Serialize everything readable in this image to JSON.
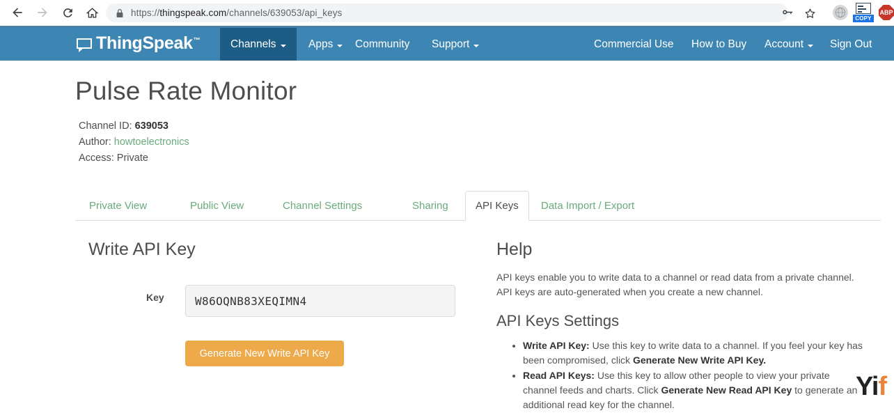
{
  "browser": {
    "back_icon": "back-arrow-icon",
    "forward_icon": "forward-arrow-icon",
    "reload_icon": "reload-icon",
    "home_icon": "home-icon",
    "lock_icon": "lock-icon",
    "url_scheme": "https://",
    "url_host": "thingspeak.com",
    "url_path": "/channels/639053/api_keys",
    "key_icon": "key-icon",
    "bookmark_icon": "star-icon",
    "extensions": [
      {
        "name": "globe-extension-icon",
        "label": ""
      },
      {
        "name": "copy-extension-icon",
        "label": "COPY"
      },
      {
        "name": "adblock-plus-extension-icon",
        "label": "ABP"
      }
    ]
  },
  "site_nav": {
    "brand": "ThingSpeak",
    "brand_tm": "™",
    "brand_icon": "speech-bubble-icon",
    "left_items": [
      {
        "label": "Channels",
        "has_caret": true,
        "active": true
      },
      {
        "label": "Apps",
        "has_caret": true,
        "active": false
      },
      {
        "label": "Community",
        "has_caret": false,
        "active": false
      },
      {
        "label": "Support",
        "has_caret": true,
        "active": false
      }
    ],
    "right_items": [
      {
        "label": "Commercial Use",
        "has_caret": false
      },
      {
        "label": "How to Buy",
        "has_caret": false
      },
      {
        "label": "Account",
        "has_caret": true
      },
      {
        "label": "Sign Out",
        "has_caret": false
      }
    ],
    "accent_color": "#3d86b3",
    "active_color": "#1c5c85"
  },
  "channel": {
    "title": "Pulse Rate Monitor",
    "id_label": "Channel ID:",
    "id_value": "639053",
    "author_label": "Author:",
    "author_value": "howtoelectronics",
    "access_label": "Access:",
    "access_value": "Private"
  },
  "tabs": [
    {
      "label": "Private View",
      "active": false
    },
    {
      "label": "Public View",
      "active": false
    },
    {
      "label": "Channel Settings",
      "active": false
    },
    {
      "label": "Sharing",
      "active": false
    },
    {
      "label": "API Keys",
      "active": true
    },
    {
      "label": "Data Import / Export",
      "active": false
    }
  ],
  "write_api_key": {
    "heading": "Write API Key",
    "key_label": "Key",
    "key_value": "W86OQNB83XEQIMN4",
    "key_placeholder": "",
    "generate_button": "Generate New Write API Key",
    "button_color": "#eda94a"
  },
  "help": {
    "heading": "Help",
    "intro": "API keys enable you to write data to a channel or read data from a private channel. API keys are auto-generated when you create a new channel.",
    "settings_heading": "API Keys Settings",
    "items": [
      {
        "term": "Write API Key:",
        "text_before": " Use this key to write data to a channel. If you feel your key has been compromised, click ",
        "bold_mid": "Generate New Write API Key.",
        "text_after": ""
      },
      {
        "term": "Read API Keys:",
        "text_before": " Use this key to allow other people to view your private channel feeds and charts. Click ",
        "bold_mid": "Generate New Read API Key",
        "text_after": " to generate an additional read key for the channel."
      }
    ]
  },
  "watermark": {
    "text_dark": "Yi",
    "text_accent": "f"
  }
}
